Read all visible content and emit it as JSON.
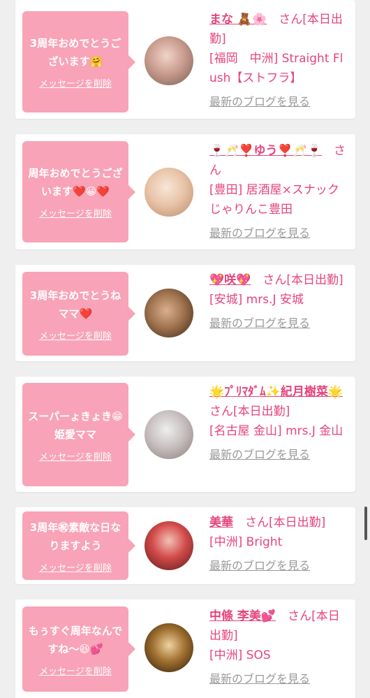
{
  "entries": [
    {
      "message": "3周年おめでとうございます🤗",
      "delete_label": "メッセージを削除",
      "girl_name": "まな 🧸🌸",
      "honorific": "さん",
      "attendance": "[本日出勤]",
      "shop": "[福岡　中洲] Straight Flush【ストフラ】",
      "blog_label": "最新のブログを見る"
    },
    {
      "message": "周年おめでとうございます❤️😀❤️",
      "delete_label": "メッセージを削除",
      "girl_name": "🍷🥂❣️ゆう❣️🥂🍷",
      "honorific": "さん",
      "attendance": "",
      "shop": "[豊田] 居酒屋×スナック じゃりんこ豊田",
      "blog_label": "最新のブログを見る"
    },
    {
      "message": "3周年おめでとうねママ❤️",
      "delete_label": "メッセージを削除",
      "girl_name": "💖咲💖",
      "honorific": "さん",
      "attendance": "[本日出勤]",
      "shop": "[安城] mrs.J 安城",
      "blog_label": "最新のブログを見る"
    },
    {
      "message": "スーパーょきょき😁姫愛ママ",
      "delete_label": "メッセージを削除",
      "girl_name": "🌟ﾌﾟﾘﾏﾀﾞﾑ✨紀月樹菜🌟",
      "honorific": "さん",
      "attendance": "[本日出勤]",
      "shop": "[名古屋 金山] mrs.J 金山",
      "blog_label": "最新のブログを見る"
    },
    {
      "message": "3周年㊗素敵な日なりますよう",
      "delete_label": "メッセージを削除",
      "girl_name": "美華",
      "honorific": "さん",
      "attendance": "[本日出勤]",
      "shop": "[中洲] Bright",
      "blog_label": "最新のブログを見る"
    },
    {
      "message": "もぅすぐ周年なんですね〜😆💕",
      "delete_label": "メッセージを削除",
      "girl_name": "中條 李美💕",
      "honorific": "さん",
      "attendance": "[本日出勤]",
      "shop": "[中洲] SOS",
      "blog_label": "最新のブログを見る"
    }
  ],
  "colors": {
    "background": "#efefef",
    "card": "#ffffff",
    "bubble": "#f8a3b7",
    "accent": "#e6457a",
    "link_gray": "#999999"
  }
}
